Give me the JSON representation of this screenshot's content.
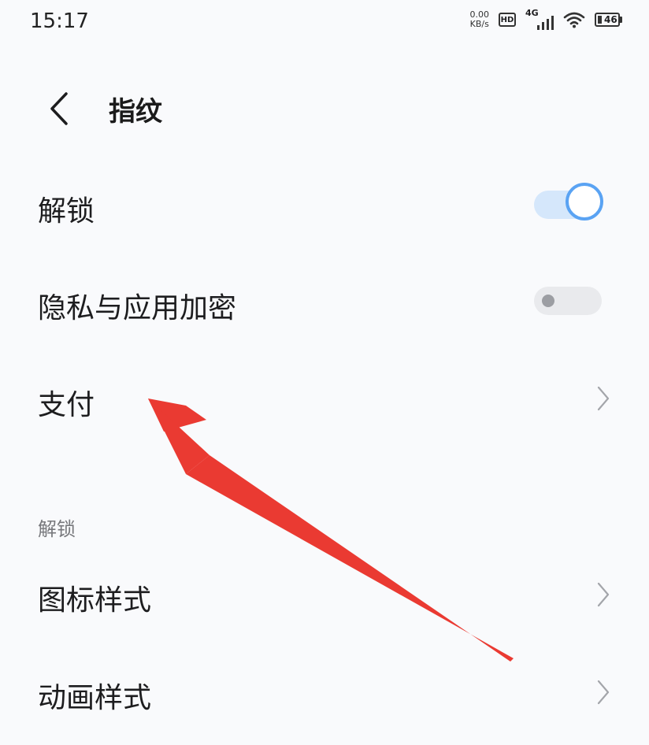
{
  "status_bar": {
    "time": "15:17",
    "net_speed_value": "0.00",
    "net_speed_unit": "KB/s",
    "hd_label": "HD",
    "network_type": "4G",
    "battery_level": "46",
    "icons": [
      "hd-icon",
      "signal-icon",
      "wifi-icon",
      "battery-icon"
    ]
  },
  "header": {
    "back_icon": "chevron-left-icon",
    "title": "指纹"
  },
  "settings": {
    "unlock": {
      "label": "解锁",
      "enabled": true
    },
    "privacy": {
      "label": "隐私与应用加密",
      "enabled": false
    },
    "payment": {
      "label": "支付"
    }
  },
  "unlock_section": {
    "header": "解锁",
    "items": [
      {
        "label": "图标样式"
      },
      {
        "label": "动画样式"
      }
    ]
  },
  "colors": {
    "toggle_on_track": "#d5e7fb",
    "toggle_on_ring": "#5aa3f3",
    "toggle_off_track": "#e9eaed",
    "annotation_arrow": "#ea3a32",
    "background": "#f9fafc"
  },
  "annotation": {
    "type": "arrow",
    "points_to": "settings.payment"
  }
}
